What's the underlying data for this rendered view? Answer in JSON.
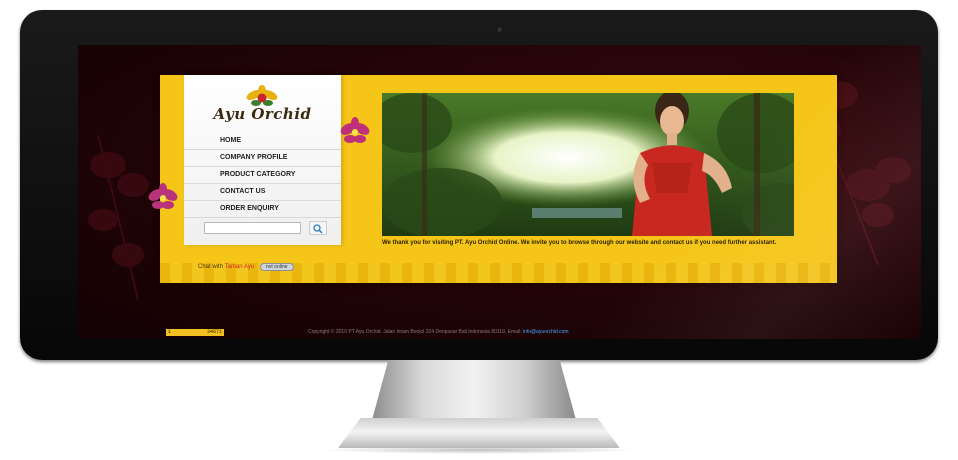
{
  "site": {
    "logo_text": "Ayu Orchid",
    "nav": [
      {
        "label": "HOME"
      },
      {
        "label": "COMPANY PROFILE"
      },
      {
        "label": "PRODUCT CATEGORY"
      },
      {
        "label": "CONTACT US"
      },
      {
        "label": "ORDER ENQUIRY"
      }
    ],
    "search": {
      "value": "",
      "icon": "search-icon"
    },
    "chat": {
      "prefix": "Chat with",
      "name": "Taman Ayu",
      "status": "not online"
    },
    "intro": "We thank you for visiting PT. Ayu Orchid Online. We invite you to browse through our website and contact us if you need further assistant."
  },
  "footer": {
    "counter_label": "1",
    "counter_value": "34671",
    "copyright": "Copyright © 2010 PT Ayu Orchid. Jalan Imam Bonjol 324 Denpasar Bali Indonesia 80119. Email:",
    "email": "info@ayuorchid.com"
  },
  "colors": {
    "site_yellow": "#f5c518",
    "screen_background": "#2a0508",
    "accent_red": "#d12a2a"
  }
}
